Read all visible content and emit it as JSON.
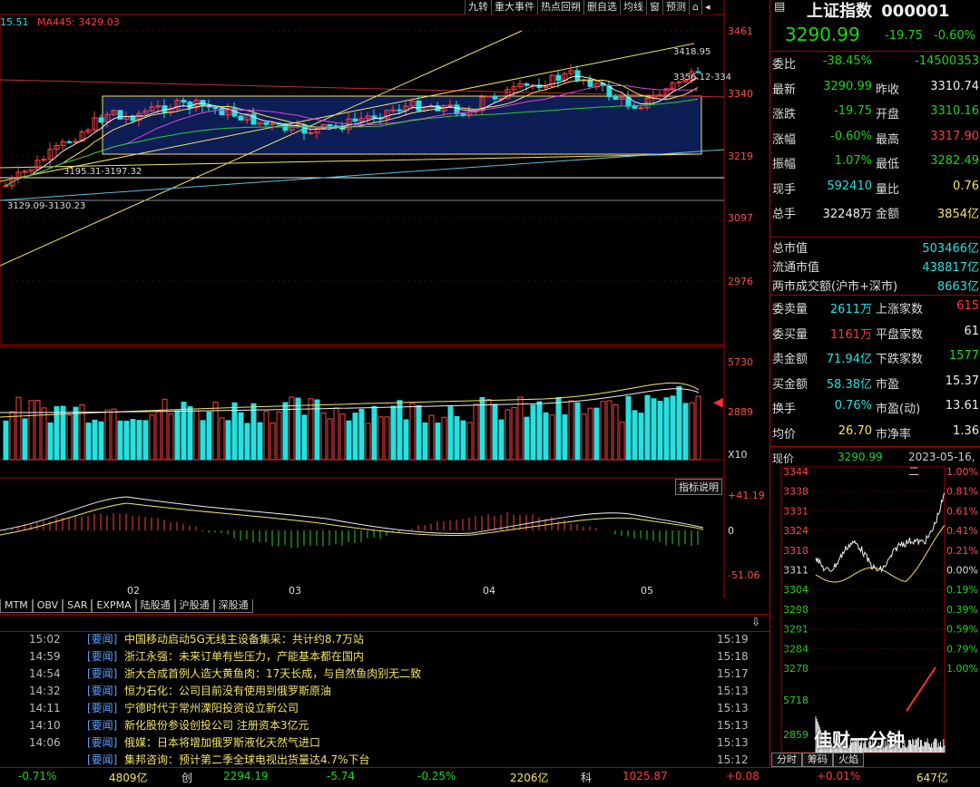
{
  "menu": [
    "九转",
    "重大事件",
    "热点回朔",
    "删自选",
    "均线",
    "窗",
    "预测"
  ],
  "legend": {
    "ma_a": "15.51",
    "ma445": "MA445: 3429.03"
  },
  "price_axis": [
    "3461",
    "3340",
    "3219",
    "3097",
    "2976"
  ],
  "vol_axis": [
    "5730",
    "2889",
    "X10"
  ],
  "macd_axis": [
    "+41.19",
    "0",
    "-51.06"
  ],
  "x_labels": [
    "02",
    "03",
    "04",
    "05"
  ],
  "annotations": {
    "high": "3418.95",
    "line1": "3356.12-334",
    "low1": "3195.31-3197.32",
    "low2": "3129.09-3130.23"
  },
  "indicator_button": "指标说明",
  "indicator_tabs": [
    "MTM",
    "OBV",
    "SAR",
    "EXPMA",
    "陆股通",
    "沪股通",
    "深股通"
  ],
  "news": [
    {
      "time": "15:02",
      "tag": "[要闻]",
      "title": "中国移动启动5G无线主设备集采：共计约8.7万站",
      "time2": "15:19"
    },
    {
      "time": "14:59",
      "tag": "[要闻]",
      "title": "浙江永强：未来订单有些压力，产能基本都在国内",
      "time2": "15:18"
    },
    {
      "time": "14:54",
      "tag": "[要闻]",
      "title": "浙大合成首例人造大黄鱼肉：17天长成，与自然鱼肉别无二致",
      "time2": "15:17"
    },
    {
      "time": "14:32",
      "tag": "[要闻]",
      "title": "恒力石化：公司目前没有使用到俄罗斯原油",
      "time2": "15:13"
    },
    {
      "time": "14:11",
      "tag": "[要闻]",
      "title": "宁德时代于常州溧阳投资设立新公司",
      "time2": "15:13"
    },
    {
      "time": "14:10",
      "tag": "[要闻]",
      "title": "新化股份参设创投公司 注册资本3亿元",
      "time2": "15:13"
    },
    {
      "time": "14:06",
      "tag": "[要闻]",
      "title": "俄媒：日本将增加俄罗斯液化天然气进口",
      "time2": "15:13"
    },
    {
      "time": "",
      "tag": "[要闻]",
      "title": "集邦咨询：预计第二季全球电视出货量达4.7%下台",
      "time2": "15:12"
    }
  ],
  "quote": {
    "name": "上证指数",
    "code": "000001",
    "price": "3290.99",
    "change": "-19.75",
    "pct": "-0.60%",
    "rows": [
      {
        "l1": "委比",
        "v1": "-38.45%",
        "c1": "grn",
        "l2": "",
        "v2": "-14500353",
        "c2": "grn"
      },
      {
        "l1": "最新",
        "v1": "3290.99",
        "c1": "grn",
        "l2": "昨收",
        "v2": "3310.74",
        "c2": "wht"
      },
      {
        "l1": "涨跌",
        "v1": "-19.75",
        "c1": "grn",
        "l2": "开盘",
        "v2": "3310.16",
        "c2": "grn"
      },
      {
        "l1": "涨幅",
        "v1": "-0.60%",
        "c1": "grn",
        "l2": "最高",
        "v2": "3317.90",
        "c2": "red"
      },
      {
        "l1": "振幅",
        "v1": "1.07%",
        "c1": "grn",
        "l2": "最低",
        "v2": "3282.49",
        "c2": "grn"
      },
      {
        "l1": "现手",
        "v1": "592410",
        "c1": "cyn",
        "l2": "量比",
        "v2": "0.76",
        "c2": "yel"
      },
      {
        "l1": "总手",
        "v1": "32248万",
        "c1": "wht",
        "l2": "金额",
        "v2": "3854亿",
        "c2": "yel"
      }
    ],
    "market": [
      {
        "l": "总市值",
        "v": "503466亿"
      },
      {
        "l": "流通市值",
        "v": "438817亿"
      },
      {
        "l": "两市成交额(沪市+深市)",
        "v": "8663亿"
      }
    ],
    "rows2": [
      {
        "l1": "委卖量",
        "v1": "2611万",
        "c1": "cyn",
        "l2": "上涨家数",
        "v2": "615",
        "c2": "red"
      },
      {
        "l1": "委买量",
        "v1": "1161万",
        "c1": "red",
        "l2": "平盘家数",
        "v2": "61",
        "c2": "wht"
      },
      {
        "l1": "卖金额",
        "v1": "71.94亿",
        "c1": "cyn",
        "l2": "下跌家数",
        "v2": "1577",
        "c2": "grn"
      },
      {
        "l1": "买金额",
        "v1": "58.38亿",
        "c1": "cyn",
        "l2": "市盈",
        "v2": "15.37",
        "c2": "wht"
      },
      {
        "l1": "换手",
        "v1": "0.76%",
        "c1": "cyn",
        "l2": "市盈(动)",
        "v2": "13.61",
        "c2": "wht"
      },
      {
        "l1": "均价",
        "v1": "26.70",
        "c1": "yel",
        "l2": "市净率",
        "v2": "1.36",
        "c2": "wht"
      }
    ],
    "mini_header": {
      "label": "现价",
      "price": "3290.99",
      "date": "2023-05-16,二"
    },
    "mini_left": [
      "3344",
      "3338",
      "3331",
      "3324",
      "3318",
      "3311",
      "3304",
      "3298",
      "3291",
      "3284",
      "3278",
      "5718",
      "2859"
    ],
    "mini_right": [
      "1.00%",
      "0.81%",
      "0.61%",
      "0.41%",
      "0.21%",
      "0.00%",
      "0.19%",
      "0.39%",
      "0.59%",
      "0.79%",
      "1.00%"
    ],
    "mini_tabs": [
      "分时",
      "筹码",
      "火焰"
    ],
    "watermark": "佳财一分钟"
  },
  "status": {
    "a": "-0.71%",
    "b": "4809亿",
    "c": "创",
    "d": "2294.19",
    "e": "-5.74",
    "f": "-0.25%",
    "g": "2206亿",
    "h": "科",
    "i": "1025.87",
    "j": "+0.08",
    "k": "+0.01%",
    "l": "647亿"
  },
  "chart_data": {
    "type": "line",
    "title": "",
    "ylim": [
      2976,
      3461
    ],
    "x": [
      "02",
      "03",
      "04",
      "05"
    ],
    "series": [
      {
        "name": "MA445",
        "values": [
          3429.03
        ]
      }
    ],
    "ylabel": "",
    "xlabel": ""
  }
}
